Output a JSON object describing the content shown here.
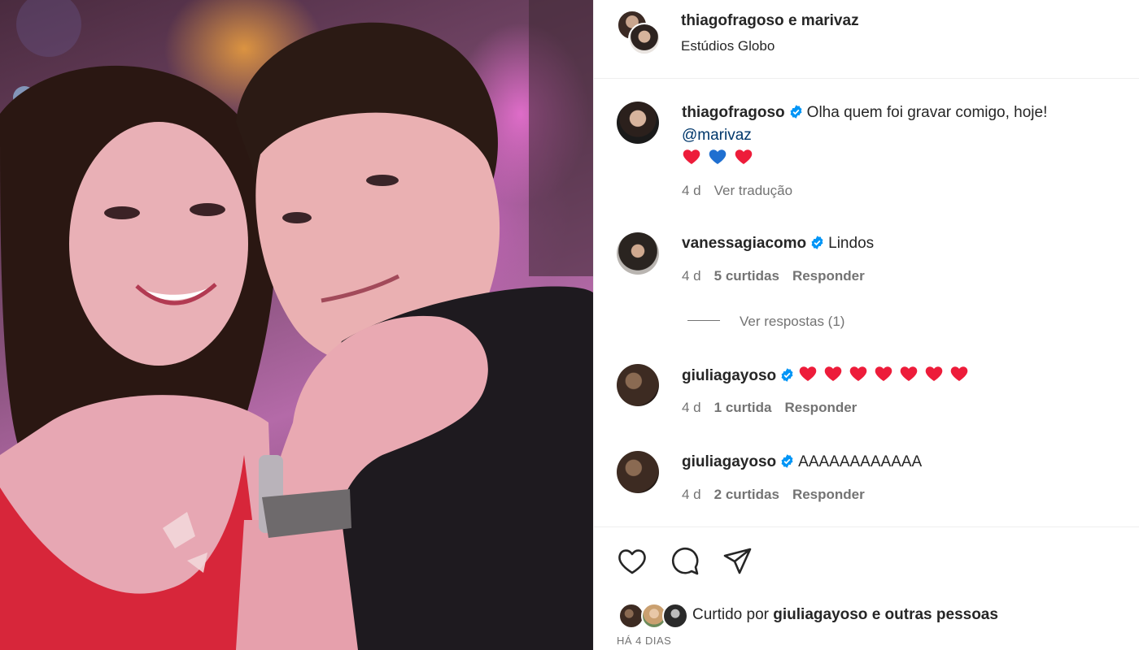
{
  "post": {
    "header_title": "thiagofragoso e marivaz",
    "header_user1": "thiagofragoso",
    "header_conj": " e ",
    "header_user2": "marivaz",
    "location": "Estúdios Globo"
  },
  "caption": {
    "username": "thiagofragoso",
    "text": "Olha quem foi gravar comigo, hoje!",
    "mention": "@marivaz",
    "emoji": "❤️💙❤️",
    "age": "4 d",
    "translate": "Ver tradução"
  },
  "comments": [
    {
      "username": "vanessagiacomo",
      "text": "Lindos",
      "age": "4 d",
      "likes": "5 curtidas",
      "reply": "Responder"
    },
    {
      "username": "giuliagayoso",
      "text": "❤️❤️❤️❤️❤️❤️❤️",
      "age": "4 d",
      "likes": "1 curtida",
      "reply": "Responder"
    },
    {
      "username": "giuliagayoso",
      "text": "AAAAAAAAAAAA",
      "age": "4 d",
      "likes": "2 curtidas",
      "reply": "Responder"
    }
  ],
  "view_replies": "Ver respostas (1)",
  "likes": {
    "prefix": "Curtido por ",
    "user": "giuliagayoso",
    "suffix": " e outras pessoas"
  },
  "date": "HÁ 4 DIAS",
  "icons": [
    "heart-icon",
    "comment-icon",
    "share-icon",
    "verified-icon"
  ],
  "colors": {
    "verified": "#0095f6",
    "heart_red": "#ed1c3a",
    "heart_blue": "#1f6fd0",
    "mention": "#00376b",
    "meta": "#737373"
  }
}
